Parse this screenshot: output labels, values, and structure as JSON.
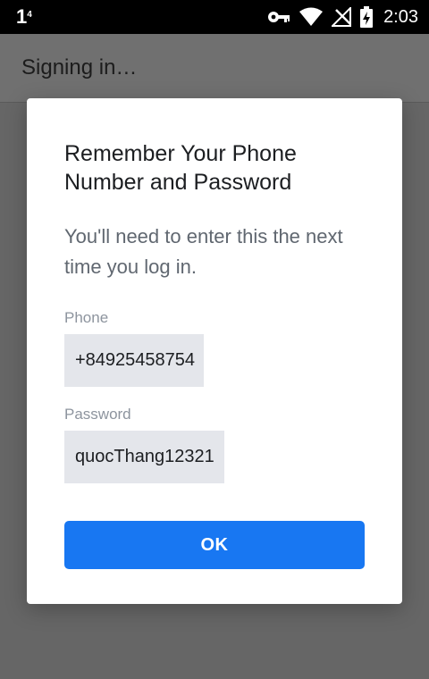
{
  "status_bar": {
    "carrier": "1",
    "carrier_sup": "4",
    "time": "2:03",
    "icons": [
      "key-icon",
      "wifi-icon",
      "no-signal-icon",
      "battery-charging-icon"
    ]
  },
  "app_bar": {
    "title": "Signing in…"
  },
  "dialog": {
    "title": "Remember Your Phone Number and Password",
    "body": "You'll need to enter this the next time you log in.",
    "phone_label": "Phone",
    "phone_value": "+84925458754",
    "password_label": "Password",
    "password_value": "quocThang12321",
    "ok_label": "OK"
  },
  "colors": {
    "accent": "#1877f2",
    "scrim": "#666666",
    "field_bg": "#e4e6eb"
  }
}
